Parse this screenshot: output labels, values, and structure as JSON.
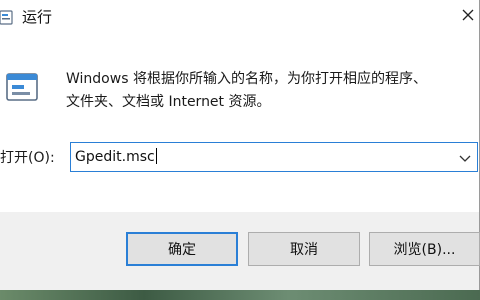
{
  "window": {
    "title": "运行",
    "close_symbol": "×"
  },
  "description": {
    "line1": "Windows 将根据你所输入的名称，为你打开相应的程序、",
    "line2": "文件夹、文档或 Internet 资源。"
  },
  "open_field": {
    "label": "打开(O):",
    "value": "Gpedit.msc"
  },
  "buttons": {
    "ok": "确定",
    "cancel": "取消",
    "browse": "浏览(B)..."
  },
  "icons": {
    "title": "run-icon",
    "dialog": "run-app-icon",
    "close": "close-icon",
    "dropdown": "chevron-down-icon"
  },
  "colors": {
    "accent": "#2a7fd6",
    "footer": "#f0f0f0",
    "button": "#e1e1e1"
  }
}
